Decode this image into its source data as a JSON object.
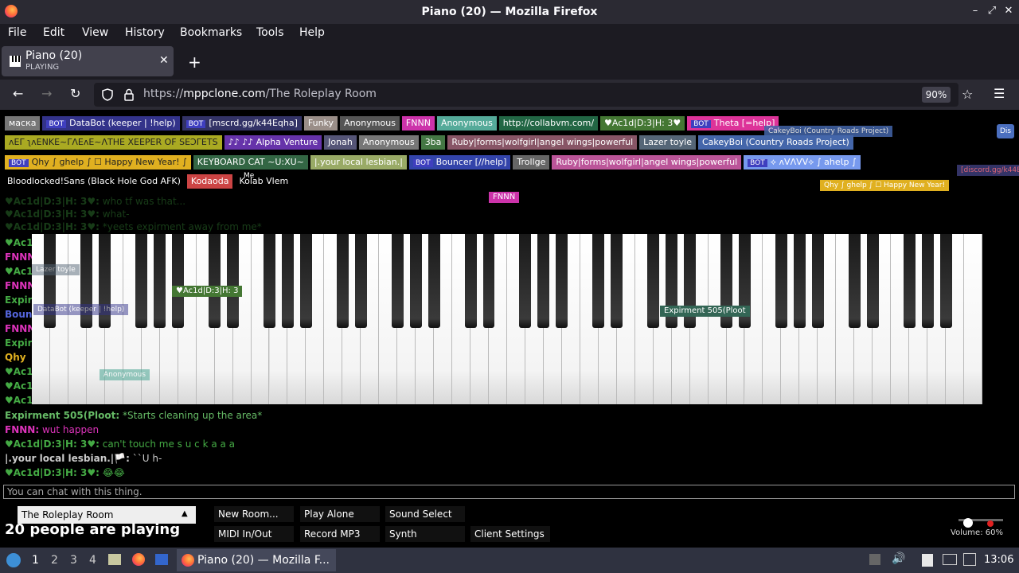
{
  "window": {
    "title": "Piano (20) — Mozilla Firefox"
  },
  "menu": [
    "File",
    "Edit",
    "View",
    "History",
    "Bookmarks",
    "Tools",
    "Help"
  ],
  "tab": {
    "title": "Piano (20)",
    "subtitle": "PLAYING"
  },
  "url": {
    "prefix": "https://",
    "domain": "mppclone.com",
    "path": "/The Roleplay Room"
  },
  "zoom": "90%",
  "players_row1": [
    {
      "label": "маска",
      "color": "#777777"
    },
    {
      "label": "DataBot (keeper | !help)",
      "color": "#33338a",
      "bot": true
    },
    {
      "label": "[mscrd.gg/k44Eqha]",
      "color": "#333366",
      "bot": true
    },
    {
      "label": "Funky",
      "color": "#9a8e88"
    },
    {
      "label": "Anonymous",
      "color": "#555555"
    },
    {
      "label": "FNNN",
      "color": "#cc33aa"
    },
    {
      "label": "Anonymous",
      "color": "#55aa99"
    },
    {
      "label": "http://collabvm.com/",
      "color": "#226644"
    },
    {
      "label": "♥Ac1d|D:3|H: 3♥",
      "color": "#447733"
    },
    {
      "label": "Theta [=help]",
      "color": "#dd3399",
      "bot": true
    }
  ],
  "players_row2": [
    {
      "label": "ʌEΓ ʅʌENKE~ΓΛΕʌE~ΛTHE ΧEEPER OF SEƆΓETS",
      "color": "#aaaa22"
    },
    {
      "label": "♪♪ ♪♪ Alpha Venture",
      "color": "#6633aa"
    },
    {
      "label": "Jonah",
      "color": "#555577"
    },
    {
      "label": "Anonymous",
      "color": "#777777"
    },
    {
      "label": "3ba",
      "color": "#447744"
    },
    {
      "label": "Ruby|forms|wolfgirl|angel wings|powerful",
      "color": "#885566"
    },
    {
      "label": "Lazer toyle",
      "color": "#556677"
    },
    {
      "label": "CakeyBoi (Country Roads Project)",
      "color": "#4466aa"
    }
  ],
  "players_row3": [
    {
      "label": "Qhy ∫ ɡhelp ∫ ☐ Happy New Year! ∫",
      "color": "#e0b020",
      "bot": true
    },
    {
      "label": "KEYBOARD CAT ~U:XU~",
      "color": "#336644"
    },
    {
      "label": "|.your local lesbian.|",
      "color": "#99aa66"
    },
    {
      "label": "Bouncer [//help]",
      "color": "#3344aa",
      "bot": true
    },
    {
      "label": "Trollge",
      "color": "#666666"
    },
    {
      "label": "Ruby|forms|wolfgirl|angel wings|powerful",
      "color": "#bb5599"
    },
    {
      "label": "⟡ ʌVɅVV⟡ ∫ aheƖp ∫",
      "color": "#7799ee",
      "bot": true
    }
  ],
  "players_row4": [
    {
      "label": "Bloodlocked!Sans (Black Hole God AFK)",
      "color": "#000000"
    },
    {
      "label": "Kodaoda",
      "color": "#cc4444"
    },
    {
      "label": "Kolab Vlem",
      "color": "#000000"
    }
  ],
  "cursor_labels": {
    "me": "Me",
    "fnnn": "FNNN",
    "acid": "♥Ac1d|D:3|H: 3",
    "expirment": "Expirment 505(Ploot",
    "anon": "Anonymous",
    "databot": "DataBot (keeper | !help)",
    "lazer": "Lazer toyle",
    "theta": "Theta",
    "qhy": "Qhy ∫ ɡhelp ∫ ☐ Happy New Year!",
    "cakey": "CakeyBoi (Country Roads Project)",
    "discord": "[discord.gg/k44E"
  },
  "chat_faint": [
    {
      "name": "♥Ac1d|D:3|H: 3♥:",
      "msg": "who tf was that...",
      "color": "#44aa44"
    },
    {
      "name": "♥Ac1d|D:3|H: 3♥:",
      "msg": "what-",
      "color": "#44aa44"
    },
    {
      "name": "♥Ac1d|D:3|H: 3♥:",
      "msg": "*yeets expirment away from me*",
      "color": "#44aa44"
    }
  ],
  "chat_left_fragments": [
    "♥Ac1",
    "FNNN",
    "♥Ac1",
    "FNNN",
    "Expir",
    "Boun",
    "FNNN",
    "Expir",
    "Qhy",
    "♥Ac1",
    "♥Ac1",
    "♥Ac1"
  ],
  "chat_lines": [
    {
      "name": "Expirment 505(Ploot:",
      "msg": "*Starts cleaning up the area*",
      "color": "#66bb66"
    },
    {
      "name": "FNNN:",
      "msg": "wut happen",
      "color": "#dd33bb"
    },
    {
      "name": "♥Ac1d|D:3|H: 3♥:",
      "msg": "can't touch me s u c k a a a",
      "color": "#44aa44"
    },
    {
      "name": "|.your local lesbian.|🏳️:",
      "msg": "``U h-",
      "color": "#cccccc"
    },
    {
      "name": "♥Ac1d|D:3|H: 3♥:",
      "msg": "😂😂",
      "color": "#44aa44"
    }
  ],
  "chat_input_placeholder": "You can chat with this thing.",
  "controls": {
    "room": "The Roleplay Room",
    "new_room": "New Room...",
    "play_alone": "Play Alone",
    "sound_select": "Sound Select",
    "midi": "MIDI In/Out",
    "record": "Record MP3",
    "synth": "Synth",
    "client_settings": "Client Settings",
    "players_count": "20",
    "players_text": "people are playing",
    "volume": "Volume: 60%"
  },
  "taskbar": {
    "workspaces": [
      "1",
      "2",
      "3",
      "4"
    ],
    "window_label": "Piano (20) — Mozilla F...",
    "clock": "13:06"
  }
}
